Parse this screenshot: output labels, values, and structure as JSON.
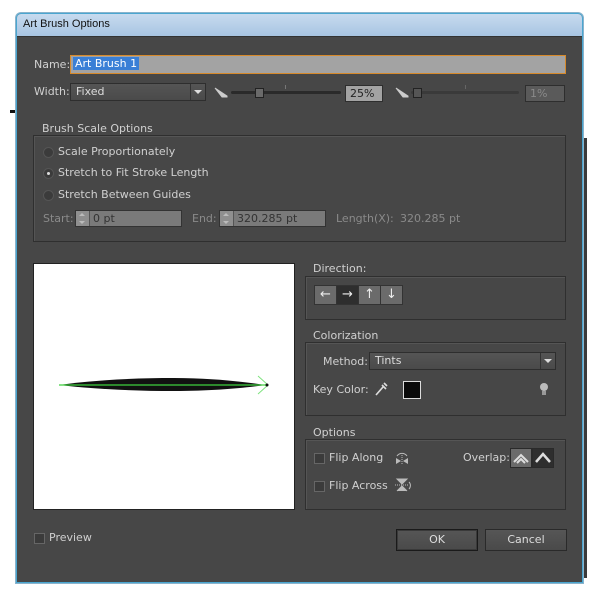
{
  "window": {
    "title": "Art Brush Options"
  },
  "name": {
    "label": "Name:",
    "value": "Art Brush 1"
  },
  "width": {
    "label": "Width:",
    "selected": "Fixed",
    "slider1_percent": 25,
    "slider1_value": "25%",
    "slider2_percent": 1,
    "slider2_value": "1%"
  },
  "brush_scale": {
    "title": "Brush Scale Options",
    "options": [
      {
        "label": "Scale Proportionately",
        "selected": false
      },
      {
        "label": "Stretch to Fit Stroke Length",
        "selected": true
      },
      {
        "label": "Stretch Between Guides",
        "selected": false
      }
    ],
    "start_label": "Start:",
    "start_value": "0 pt",
    "end_label": "End:",
    "end_value": "320.285 pt",
    "length_label": "Length(X):",
    "length_value": "320.285 pt"
  },
  "direction": {
    "title": "Direction:",
    "buttons": [
      {
        "icon": "arrow-left-icon",
        "glyph": "←",
        "selected": false
      },
      {
        "icon": "arrow-right-icon",
        "glyph": "→",
        "selected": true
      },
      {
        "icon": "arrow-up-icon",
        "glyph": "↑",
        "selected": false
      },
      {
        "icon": "arrow-down-icon",
        "glyph": "↓",
        "selected": false
      }
    ]
  },
  "colorization": {
    "title": "Colorization",
    "method_label": "Method:",
    "method_value": "Tints",
    "key_color_label": "Key Color:",
    "key_color": "#0a0a0a"
  },
  "options": {
    "title": "Options",
    "flip_along_label": "Flip Along",
    "flip_along_checked": false,
    "flip_across_label": "Flip Across",
    "flip_across_checked": false,
    "overlap_label": "Overlap:"
  },
  "footer": {
    "preview_label": "Preview",
    "preview_checked": false,
    "ok_label": "OK",
    "cancel_label": "Cancel"
  },
  "colors": {
    "panel": "#474747",
    "name_highlight": "#3a7fd6",
    "name_border": "#d78a2b",
    "stroke_guide": "#3fd13f"
  }
}
